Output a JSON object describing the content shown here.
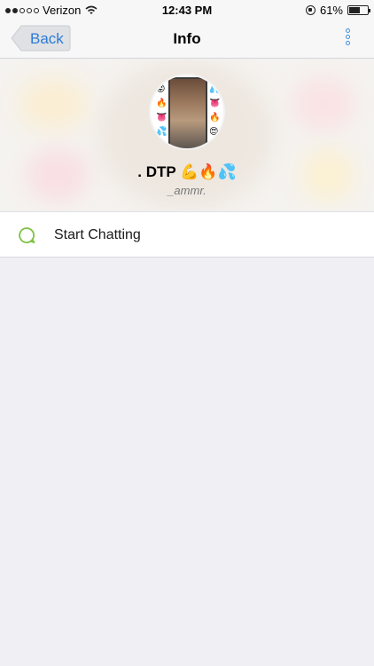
{
  "status_bar": {
    "carrier": "Verizon",
    "time": "12:43 PM",
    "battery_text": "61%",
    "battery_level": 0.61,
    "signal_bars_filled": 2,
    "signal_bars_total": 5
  },
  "nav": {
    "back_label": "Back",
    "title": "Info",
    "more_icon": "vertical-dots-icon"
  },
  "profile": {
    "name": ". DTP",
    "name_emojis": "💪🔥💦",
    "username": "_ammr."
  },
  "actions": [
    {
      "label": "Start Chatting",
      "icon": "chat-bubble-icon"
    }
  ],
  "colors": {
    "accent": "#2d7bd6",
    "chat_icon": "#7dc242",
    "background": "#efeff4"
  }
}
